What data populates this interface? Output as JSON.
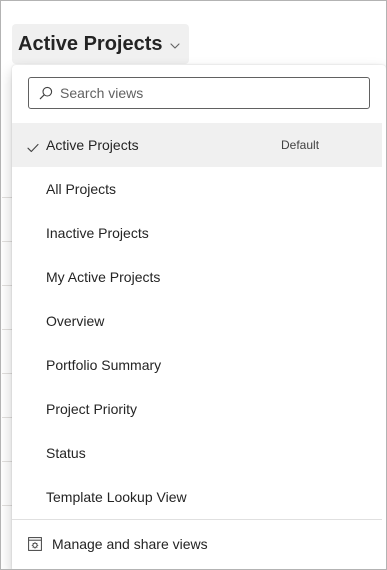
{
  "header": {
    "view_title": "Active Projects",
    "chevron_icon": "chevron-down-icon"
  },
  "flyout": {
    "search": {
      "placeholder": "Search views",
      "value": "",
      "icon": "search-icon"
    },
    "views": [
      {
        "label": "Active Projects",
        "selected": true,
        "badge": "Default"
      },
      {
        "label": "All Projects"
      },
      {
        "label": "Inactive Projects"
      },
      {
        "label": "My Active Projects"
      },
      {
        "label": "Overview"
      },
      {
        "label": "Portfolio Summary"
      },
      {
        "label": "Project Priority"
      },
      {
        "label": "Status"
      },
      {
        "label": "Template Lookup View"
      }
    ],
    "manage": {
      "label": "Manage and share views",
      "icon": "settings-window-icon"
    }
  },
  "colors": {
    "selected_bg": "#f0f0f0",
    "text": "#242424",
    "border": "#616161"
  }
}
